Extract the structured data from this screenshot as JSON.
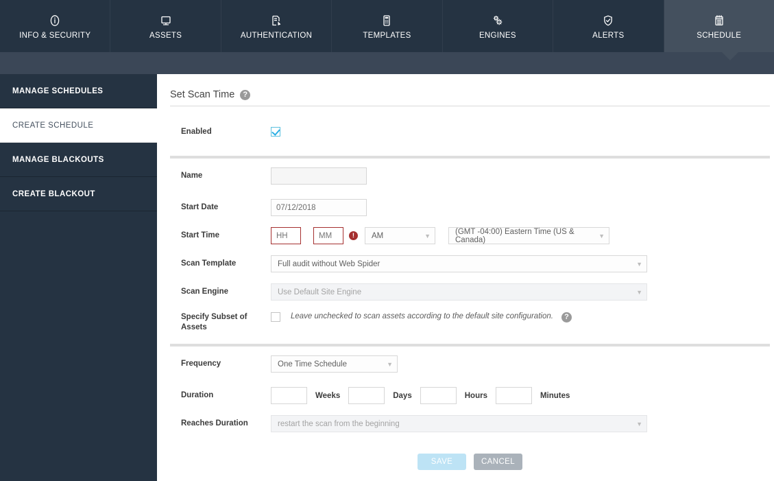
{
  "topnav": {
    "tabs": [
      {
        "label": "INFO & SECURITY",
        "icon": "info-circle-icon",
        "active": false
      },
      {
        "label": "ASSETS",
        "icon": "monitor-icon",
        "active": false
      },
      {
        "label": "AUTHENTICATION",
        "icon": "document-pen-icon",
        "active": false
      },
      {
        "label": "TEMPLATES",
        "icon": "calculator-icon",
        "active": false
      },
      {
        "label": "ENGINES",
        "icon": "gears-icon",
        "active": false
      },
      {
        "label": "ALERTS",
        "icon": "shield-check-icon",
        "active": false
      },
      {
        "label": "SCHEDULE",
        "icon": "calendar-icon",
        "active": true
      }
    ]
  },
  "sidebar": {
    "items": [
      {
        "label": "MANAGE SCHEDULES",
        "active": false
      },
      {
        "label": "CREATE SCHEDULE",
        "active": true
      },
      {
        "label": "MANAGE BLACKOUTS",
        "active": false
      },
      {
        "label": "CREATE BLACKOUT",
        "active": false
      }
    ]
  },
  "main": {
    "page_title": "Set Scan Time",
    "help_glyph": "?",
    "rows": {
      "enabled": {
        "label": "Enabled",
        "checked": true
      },
      "name": {
        "label": "Name",
        "value": "",
        "placeholder": ""
      },
      "start_date": {
        "label": "Start Date",
        "value": "07/12/2018"
      },
      "start_time": {
        "label": "Start Time",
        "hour_placeholder": "HH",
        "minute_placeholder": "MM",
        "hour_value": "",
        "minute_value": "",
        "error_glyph": "!",
        "meridiem": "AM",
        "timezone": "(GMT -04:00) Eastern Time (US & Canada)"
      },
      "scan_template": {
        "label": "Scan Template",
        "value": "Full audit without Web Spider"
      },
      "scan_engine": {
        "label": "Scan Engine",
        "value": "Use Default Site Engine",
        "disabled": true
      },
      "specify_subset": {
        "label": "Specify Subset of Assets",
        "checked": false,
        "hint": "Leave unchecked to scan assets according to the default site configuration."
      },
      "frequency": {
        "label": "Frequency",
        "value": "One Time Schedule"
      },
      "duration": {
        "label": "Duration",
        "weeks_value": "",
        "weeks_unit": "Weeks",
        "days_value": "",
        "days_unit": "Days",
        "hours_value": "",
        "hours_unit": "Hours",
        "minutes_value": "",
        "minutes_unit": "Minutes"
      },
      "reaches_duration": {
        "label": "Reaches Duration",
        "value": "restart the scan from the beginning",
        "disabled": true
      }
    },
    "buttons": {
      "save": "SAVE",
      "cancel": "CANCEL"
    }
  },
  "colors": {
    "nav_bg": "#253342",
    "nav_active_bg": "#44505e",
    "subbar_bg": "#3b4757",
    "error_red": "#a52f2f",
    "accent_blue": "#29aee5",
    "save_disabled": "#bde3f5",
    "cancel_gray": "#aab2ba"
  }
}
